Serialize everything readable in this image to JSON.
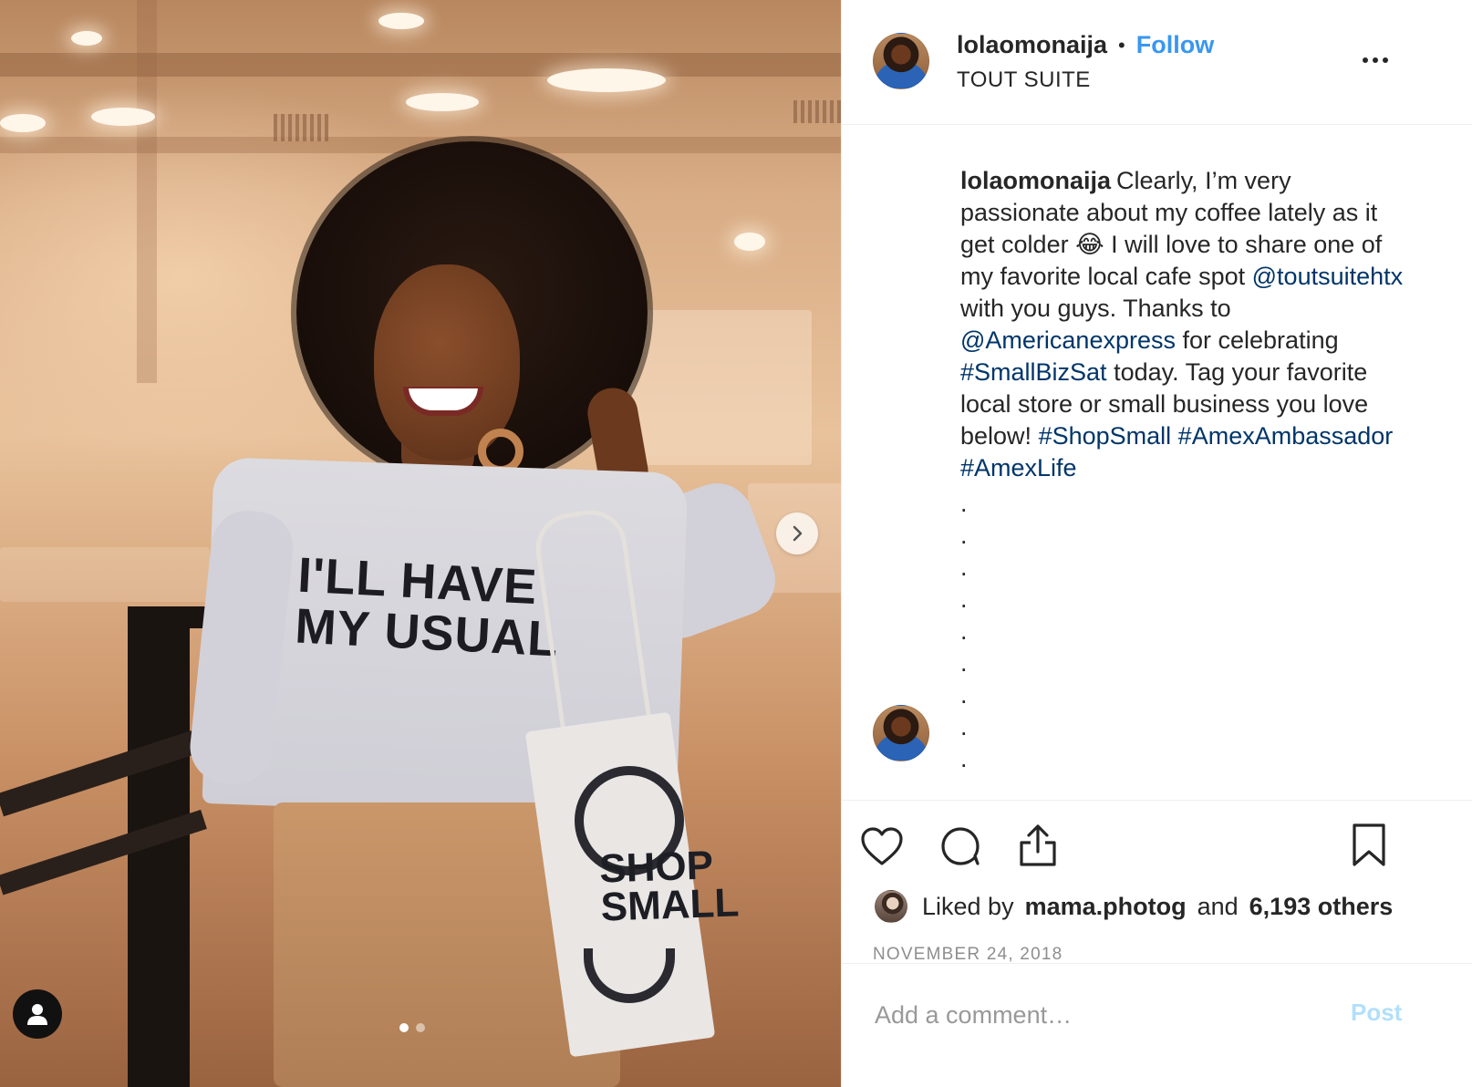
{
  "post": {
    "username": "lolaomonaija",
    "bullet": "•",
    "follow_label": "Follow",
    "location": "TOUT SUITE",
    "more_icon": "more-horizontal-icon"
  },
  "photo": {
    "shirt_line_1": "I'LL HAVE",
    "shirt_line_2": "MY USUAL",
    "tote_line_1": "SHOP",
    "tote_line_2": "SMALL",
    "carousel_count": 2,
    "carousel_active": 0,
    "next_icon": "chevron-right-icon",
    "tag_icon": "user-icon"
  },
  "caption": {
    "username": "lolaomonaija",
    "text_1": "Clearly, I’m very passionate about my coffee lately as it get colder ",
    "emoji": "😂",
    "text_2": " I will love to share one of my favorite local cafe spot ",
    "mention_1": "@toutsuitehtx",
    "text_3": " with you guys. Thanks to ",
    "mention_2": "@Americanexpress",
    "text_4": " for celebrating ",
    "hashtag_1": "#SmallBizSat",
    "text_5": " today. Tag your favorite local store or small business you love below! ",
    "hashtag_2": "#ShopSmall",
    "hashtag_3": "#AmexAmbassador",
    "hashtag_4": "#AmexLife",
    "trailing_dots": [
      ".",
      ".",
      ".",
      ".",
      ".",
      ".",
      ".",
      ".",
      "."
    ]
  },
  "actions": {
    "like_icon": "heart-icon",
    "comment_icon": "comment-icon",
    "share_icon": "share-icon",
    "save_icon": "bookmark-icon"
  },
  "likes": {
    "prefix": "Liked by",
    "user": "mama.photog",
    "and": "and",
    "others": "6,193 others"
  },
  "date": "NOVEMBER 24, 2018",
  "comment": {
    "placeholder": "Add a comment…",
    "post_label": "Post"
  },
  "colors": {
    "link": "#003569",
    "follow": "#3897f0",
    "post_disabled": "#b2dffc",
    "muted": "#8e8e8e"
  }
}
